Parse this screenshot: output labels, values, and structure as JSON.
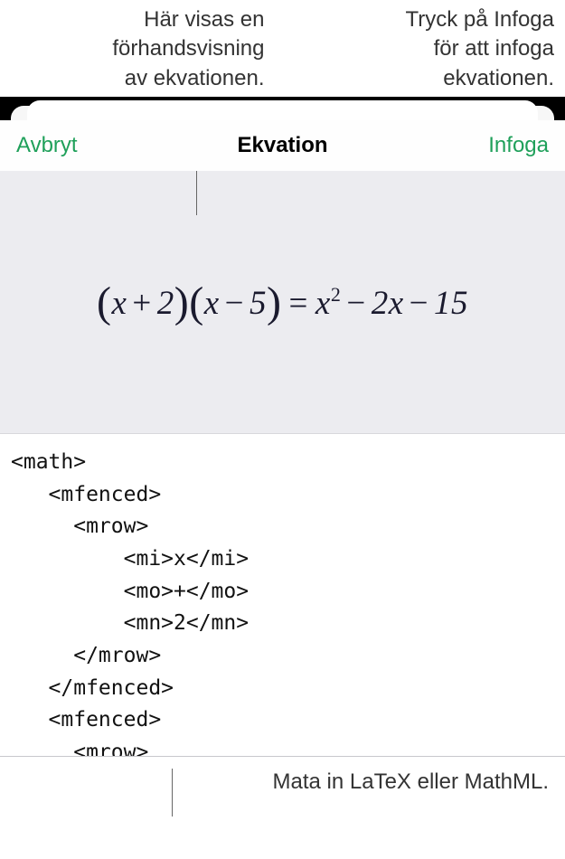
{
  "callouts": {
    "preview": "Här visas en\nförhandsvisning\nav ekvationen.",
    "insert": "Tryck på Infoga\nför att infoga\nekvationen.",
    "input": "Mata in LaTeX eller MathML."
  },
  "toolbar": {
    "cancel": "Avbryt",
    "title": "Ekvation",
    "insert": "Infoga"
  },
  "equation_rendered": {
    "lhs_factor1_var": "x",
    "lhs_factor1_op": "+",
    "lhs_factor1_num": "2",
    "lhs_factor2_var": "x",
    "lhs_factor2_op": "−",
    "lhs_factor2_num": "5",
    "eq": "=",
    "rhs_term1_var": "x",
    "rhs_term1_exp": "2",
    "rhs_op1": "−",
    "rhs_term2_coef": "2",
    "rhs_term2_var": "x",
    "rhs_op2": "−",
    "rhs_term3": "15"
  },
  "editor": {
    "code": "<math>\n   <mfenced>\n     <mrow>\n         <mi>x</mi>\n         <mo>+</mo>\n         <mn>2</mn>\n     </mrow>\n   </mfenced>\n   <mfenced>\n     <mrow>"
  }
}
